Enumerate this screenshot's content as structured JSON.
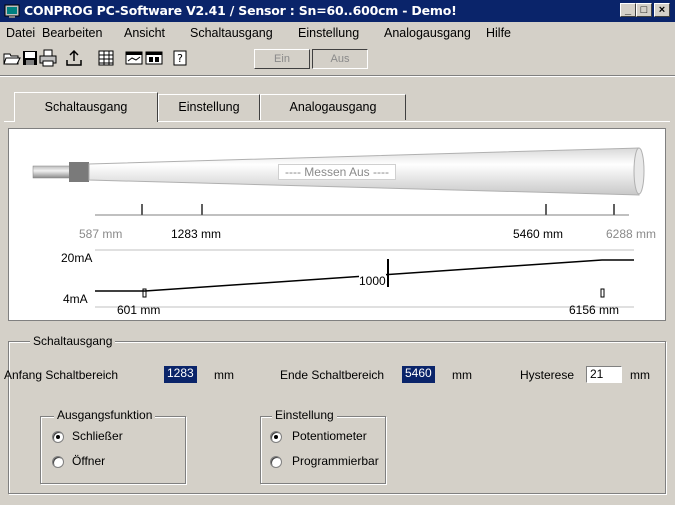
{
  "window": {
    "title": "CONPROG PC-Software V2.41 / Sensor : Sn=60..600cm - Demo!",
    "minimize": "_",
    "maximize": "□",
    "close": "×"
  },
  "menu": [
    "Datei",
    "Bearbeiten",
    "Ansicht",
    "Schaltausgang",
    "Einstellung",
    "Analogausgang",
    "Hilfe"
  ],
  "toolbar": {
    "icons": [
      "open-icon",
      "save-icon",
      "print-icon",
      "upload-icon",
      "grid-icon",
      "chart-icon",
      "window-icon",
      "help-icon"
    ],
    "ein_label": "Ein",
    "aus_label": "Aus"
  },
  "tabs": [
    "Schaltausgang",
    "Einstellung",
    "Analogausgang"
  ],
  "sensor": {
    "status_text": "----  Messen Aus  ----",
    "scale": {
      "min_label": "587 mm",
      "start_label": "1283 mm",
      "end_label": "5460 mm",
      "max_label": "6288 mm"
    },
    "analog": {
      "label_20ma": "20mA",
      "label_4ma": "4mA",
      "low_label": "601 mm",
      "high_label": "6156 mm",
      "marker_label": "1000"
    }
  },
  "schaltausgang": {
    "group_title": "Schaltausgang",
    "anfang_label": "Anfang Schaltbereich",
    "anfang_value": "1283",
    "anfang_unit": "mm",
    "ende_label": "Ende Schaltbereich",
    "ende_value": "5460",
    "ende_unit": "mm",
    "hysterese_label": "Hysterese",
    "hysterese_value": "21",
    "hysterese_unit": "mm",
    "ausgangsfunktion": {
      "title": "Ausgangsfunktion",
      "options": [
        "Schließer",
        "Öffner"
      ],
      "selected": "Schließer"
    },
    "einstellung": {
      "title": "Einstellung",
      "options": [
        "Potentiometer",
        "Programmierbar"
      ],
      "selected": "Potentiometer"
    }
  }
}
